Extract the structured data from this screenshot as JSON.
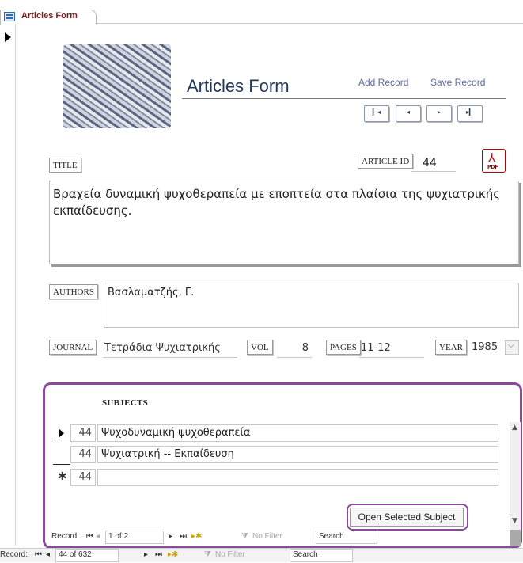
{
  "tab": {
    "label": "Articles Form",
    "icon": "form-icon"
  },
  "header": {
    "title": "Articles Form",
    "add_record": "Add Record",
    "save_record": "Save Record",
    "nav": {
      "first": "H",
      "prev": "◂",
      "next": "▸",
      "last": "H"
    }
  },
  "fields": {
    "title_label": "TITLE",
    "title_value": "Βραχεία δυναμική ψυχοθεραπεία με εποπτεία στα πλαίσια της ψυχιατρικής εκπαίδευσης.",
    "article_id_label": "ARTICLE ID",
    "article_id_value": "44",
    "pdf_tag": "PDF",
    "authors_label": "AUTHORS",
    "authors_value": "Βασλαματζής, Γ.",
    "journal_label": "JOURNAL",
    "journal_value": "Τετράδια Ψυχιατρικής",
    "vol_label": "VOL",
    "vol_value": "8",
    "pages_label": "PAGES",
    "pages_value": "11-12",
    "year_label": "YEAR",
    "year_value": "1985"
  },
  "subjects": {
    "label": "SUBJECTS",
    "rows": [
      {
        "id": "44",
        "subject": "Ψυχοδυναμική ψυχοθεραπεία"
      },
      {
        "id": "44",
        "subject": "Ψυχιατρική -- Εκπαίδευση"
      }
    ],
    "new_row": {
      "marker": "✱",
      "id": "44",
      "subject": ""
    },
    "open_button": "Open Selected Subject"
  },
  "subform_nav": {
    "record_label": "Record:",
    "position": "1 of 2",
    "filter": "No Filter",
    "search": "Search"
  },
  "main_nav": {
    "record_label": "Record:",
    "position": "44 of 632",
    "filter": "No Filter",
    "search": "Search"
  }
}
